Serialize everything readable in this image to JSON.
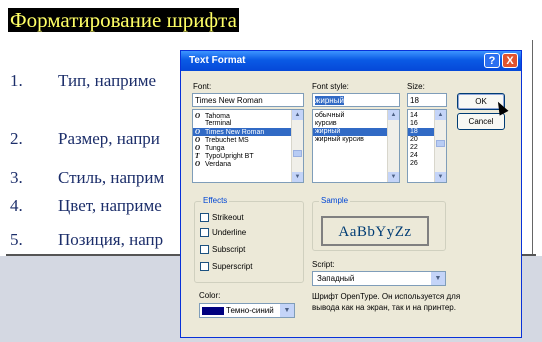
{
  "document": {
    "title": "Форматирование шрифта",
    "items": [
      {
        "num": "1.",
        "text": "Тип, наприме"
      },
      {
        "num": "2.",
        "text": "Размер, напри"
      },
      {
        "num": "3.",
        "text": "Стиль, наприм"
      },
      {
        "num": "4.",
        "text": "Цвет, наприме"
      },
      {
        "num": "5.",
        "text": "Позиция, напр"
      }
    ]
  },
  "dialog": {
    "title": "Text Format",
    "help_label": "?",
    "close_label": "X",
    "font": {
      "label": "Font:",
      "value": "Times New Roman",
      "options": [
        {
          "icon": "O",
          "label": "Tahoma"
        },
        {
          "icon": "",
          "label": "Terminal"
        },
        {
          "icon": "O",
          "label": "Times New Roman",
          "selected": true
        },
        {
          "icon": "O",
          "label": "Trebuchet MS"
        },
        {
          "icon": "O",
          "label": "Tunga"
        },
        {
          "icon": "T",
          "label": "TypoUpright BT"
        },
        {
          "icon": "O",
          "label": "Verdana"
        }
      ]
    },
    "style": {
      "label": "Font style:",
      "value": "жирный",
      "options": [
        {
          "label": "обычный"
        },
        {
          "label": "курсив"
        },
        {
          "label": "жирный",
          "selected": true
        },
        {
          "label": "жирный курсив"
        }
      ]
    },
    "size": {
      "label": "Size:",
      "value": "18",
      "options": [
        {
          "label": "14"
        },
        {
          "label": "16"
        },
        {
          "label": "18",
          "selected": true
        },
        {
          "label": "20"
        },
        {
          "label": "22"
        },
        {
          "label": "24"
        },
        {
          "label": "26"
        }
      ]
    },
    "ok_label": "OK",
    "cancel_label": "Cancel",
    "effects": {
      "label": "Effects",
      "options": [
        "Strikeout",
        "Underline",
        "Subscript",
        "Superscript"
      ]
    },
    "sample": {
      "label": "Sample",
      "text": "AaBbYyZz"
    },
    "script": {
      "label": "Script:",
      "value": "Западный"
    },
    "color": {
      "label": "Color:",
      "value": "Темно-синий",
      "swatch": "#00007f"
    },
    "info_text": "Шрифт OpenType. Он используется для вывода как на экран, так и на принтер."
  }
}
